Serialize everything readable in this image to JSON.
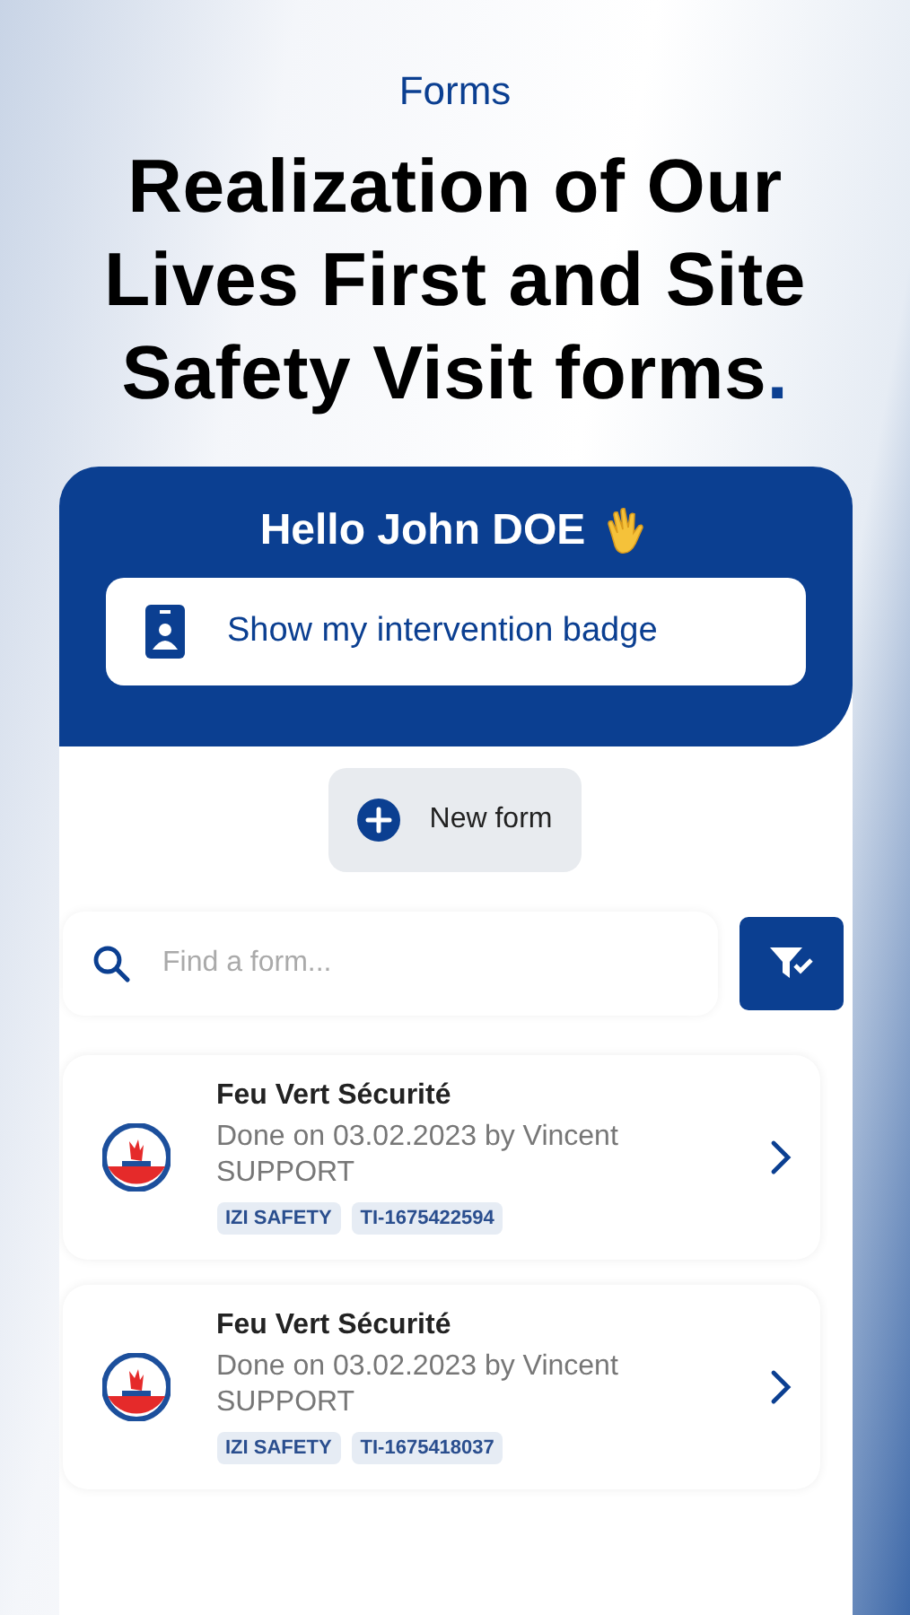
{
  "page_label": "Forms",
  "headline": {
    "text": "Realization of Our Lives First and Site Safety Visit forms",
    "accent": "."
  },
  "greeting": "Hello John DOE",
  "badge_button": "Show my intervention badge",
  "new_form_button": "New form",
  "search": {
    "placeholder": "Find a form..."
  },
  "forms": [
    {
      "title": "Feu Vert Sécurité",
      "subtitle": "Done on 03.02.2023 by Vincent SUPPORT",
      "tags": [
        "IZI SAFETY",
        "TI-1675422594"
      ]
    },
    {
      "title": "Feu Vert Sécurité",
      "subtitle": "Done on 03.02.2023 by Vincent SUPPORT",
      "tags": [
        "IZI SAFETY",
        "TI-1675418037"
      ]
    }
  ]
}
